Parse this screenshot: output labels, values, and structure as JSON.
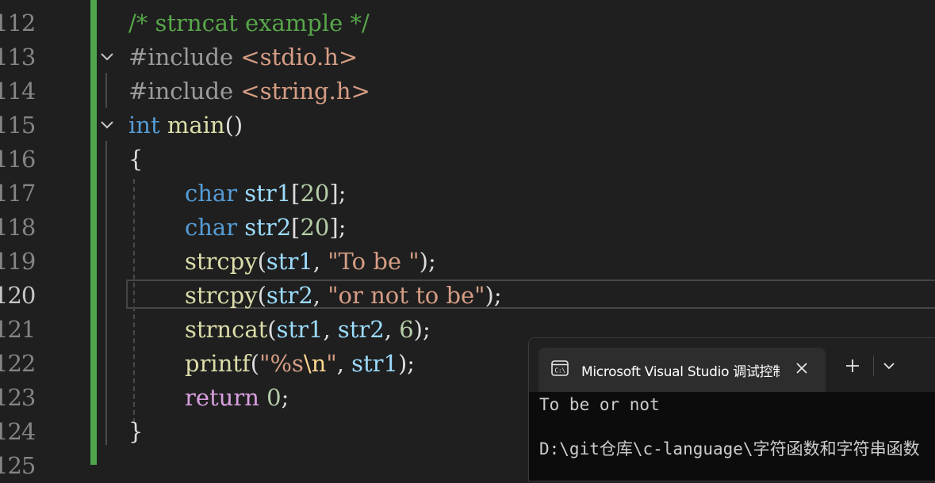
{
  "editor": {
    "line_numbers": [
      "112",
      "113",
      "114",
      "115",
      "116",
      "117",
      "118",
      "119",
      "120",
      "121",
      "122",
      "123",
      "124",
      "125"
    ],
    "active_line": "120",
    "code": {
      "l112": "/* strncat example */",
      "l113_directive": "#include",
      "l113_header": "<stdio.h>",
      "l114_directive": "#include",
      "l114_header": "<string.h>",
      "l115_type": "int",
      "l115_name": "main",
      "l115_parens": "()",
      "l116": "{",
      "l117_type": "char",
      "l117_var": "str1",
      "l117_open": "[",
      "l117_num": "20",
      "l117_close": "];",
      "l118_type": "char",
      "l118_var": "str2",
      "l118_open": "[",
      "l118_num": "20",
      "l118_close": "];",
      "l119_fn": "strcpy",
      "l119_open": "(",
      "l119_var": "str1",
      "l119_comma": ", ",
      "l119_str": "\"To be \"",
      "l119_close": ");",
      "l120_fn": "strcpy",
      "l120_open": "(",
      "l120_var": "str2",
      "l120_comma": ", ",
      "l120_str": "\"or not to be\"",
      "l120_close": ");",
      "l121_fn": "strncat",
      "l121_open": "(",
      "l121_var1": "str1",
      "l121_comma1": ", ",
      "l121_var2": "str2",
      "l121_comma2": ", ",
      "l121_num": "6",
      "l121_close": ");",
      "l122_fn": "printf",
      "l122_open": "(",
      "l122_str1": "\"%s",
      "l122_esc": "\\n",
      "l122_str2": "\"",
      "l122_comma": ", ",
      "l122_var": "str1",
      "l122_close": ");",
      "l123_kw": "return",
      "l123_num": "0",
      "l123_semi": ";",
      "l124": "}"
    }
  },
  "terminal": {
    "tab_title": "Microsoft Visual Studio 调试控制台",
    "icons": {
      "tab": "console-icon",
      "close": "close-icon",
      "new_tab": "plus-icon",
      "dropdown": "chevron-down-icon"
    },
    "output_line1": "To be or not",
    "output_line2": "D:\\git仓库\\c-language\\字符函数和字符串函数"
  },
  "colors": {
    "change_bar": "#4ea54b",
    "keyword": "#569cd6",
    "control_keyword": "#d8a0df",
    "string": "#d69d85",
    "function": "#dcdcaa",
    "variable": "#9cdcfe",
    "number": "#b5cea8",
    "comment": "#57a64a"
  }
}
